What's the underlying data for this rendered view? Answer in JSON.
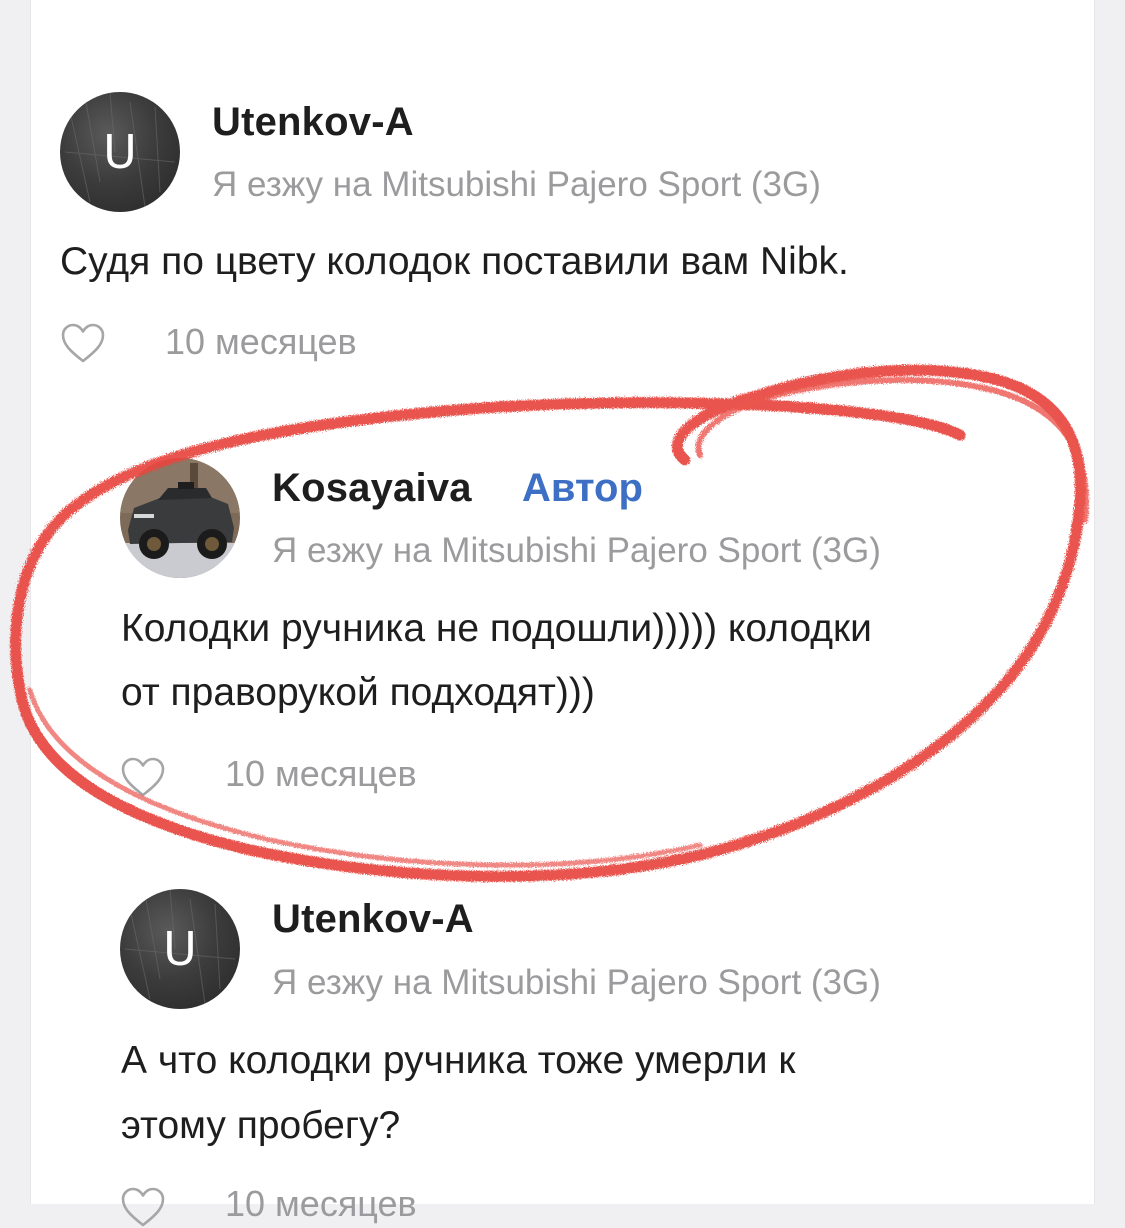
{
  "comments": [
    {
      "username": "Utenkov-A",
      "avatar_letter": "U",
      "car_line": "Я езжу на Mitsubishi Pajero Sport (3G)",
      "text_lines": [
        "Судя по цвету колодок поставили вам Nibk."
      ],
      "time": "10 месяцев",
      "like_icon": "heart-outline-icon"
    },
    {
      "username": "Kosayaiva",
      "badge": "Автор",
      "car_line": "Я езжу на Mitsubishi Pajero Sport (3G)",
      "text_lines": [
        "Колодки ручника не подошли))))) колодки",
        "от праворукой подходят)))"
      ],
      "time": "10 месяцев",
      "like_icon": "heart-outline-icon"
    },
    {
      "username": "Utenkov-A",
      "avatar_letter": "U",
      "car_line": "Я езжу на Mitsubishi Pajero Sport (3G)",
      "text_lines": [
        "А что колодки ручника тоже умерли к",
        "этому пробегу?"
      ],
      "time": "10 месяцев",
      "like_icon": "heart-outline-icon"
    }
  ],
  "colors": {
    "author_badge": "#3d70c4",
    "scribble": "#e8463f",
    "secondary_text": "#9b9b9e"
  }
}
